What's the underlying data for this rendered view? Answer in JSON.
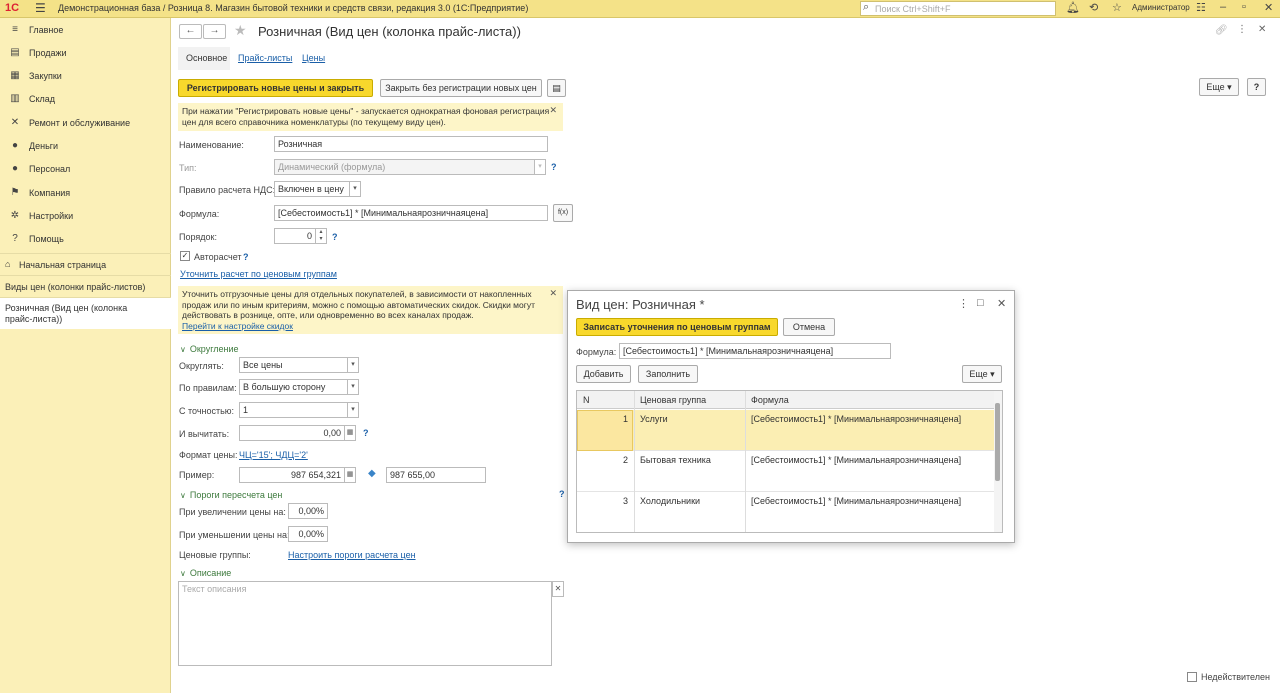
{
  "titlebar": {
    "logo": "1С",
    "title": "Демонстрационная база / Розница 8. Магазин бытовой техники и средств связи, редакция 3.0  (1С:Предприятие)",
    "search_placeholder": "Поиск Ctrl+Shift+F",
    "user": "Администратор"
  },
  "sidebar": {
    "items": [
      {
        "label": "Главное",
        "icon": "menu-icon"
      },
      {
        "label": "Продажи",
        "icon": "sales-icon"
      },
      {
        "label": "Закупки",
        "icon": "purchases-icon"
      },
      {
        "label": "Склад",
        "icon": "warehouse-icon"
      },
      {
        "label": "Ремонт и обслуживание",
        "icon": "wrench-icon"
      },
      {
        "label": "Деньги",
        "icon": "money-icon"
      },
      {
        "label": "Персонал",
        "icon": "person-icon"
      },
      {
        "label": "Компания",
        "icon": "flag-icon"
      },
      {
        "label": "Настройки",
        "icon": "gear-icon"
      },
      {
        "label": "Помощь",
        "icon": "help-icon"
      }
    ],
    "home": "Начальная страница",
    "open_windows": [
      "Виды цен (колонки прайс-листов)",
      "Розничная (Вид цен (колонка прайс-листа))"
    ]
  },
  "form": {
    "title": "Розничная (Вид цен (колонка прайс-листа))",
    "tabs": [
      "Основное",
      "Прайс-листы",
      "Цены"
    ],
    "btn_register": "Регистрировать новые цены и закрыть",
    "btn_close_no_reg": "Закрыть без регистрации новых цен",
    "btn_more": "Еще",
    "note1": "При нажатии \"Регистрировать новые цены\" - запускается однократная фоновая регистрация цен для всего справочника номенклатуры (по текущему виду цен).",
    "name_label": "Наименование:",
    "name_value": "Розничная",
    "type_label": "Тип:",
    "type_value": "Динамический (формула)",
    "vat_label": "Правило расчета НДС:",
    "vat_value": "Включен в цену",
    "formula_label": "Формула:",
    "formula_value": "[Себестоимость1] * [Минимальнаярозничнаяцена]",
    "order_label": "Порядок:",
    "order_value": "0",
    "autocalc_label": "Авторасчет",
    "refine_link": "Уточнить расчет по ценовым группам",
    "note2": "Уточнить отгрузочные цены для отдельных покупателей, в зависимости от накопленных продаж или по иным критериям, можно с помощью автоматических скидок. Скидки могут действовать в рознице, опте, или одновременно во всех каналах продаж.",
    "note2_link": "Перейти к настройке скидок",
    "rounding_section": "Округление",
    "round_label": "Округлять:",
    "round_value": "Все цены",
    "rule_label": "По правилам:",
    "rule_value": "В большую сторону",
    "precision_label": "С точностью:",
    "precision_value": "1",
    "subtract_label": "И вычитать:",
    "subtract_value": "0,00",
    "format_label": "Формат цены:",
    "format_value": "ЧЦ='15'; ЧДЦ='2'",
    "example_label": "Пример:",
    "example_value": "987 654,321",
    "example_result": "987 655,00",
    "thresholds_section": "Пороги пересчета цен",
    "increase_label": "При увеличении цены на:",
    "increase_value": "0,00%",
    "decrease_label": "При уменьшении цены на:",
    "decrease_value": "0,00%",
    "groups_label": "Ценовые группы:",
    "groups_link": "Настроить пороги расчета цен",
    "description_section": "Описание",
    "description_placeholder": "Текст описания",
    "invalid_label": "Недействителен",
    "question_mark": "?"
  },
  "dialog": {
    "title": "Вид цен: Розничная *",
    "btn_save": "Записать уточнения по ценовым группам",
    "btn_cancel": "Отмена",
    "formula_label": "Формула:",
    "formula_value": "[Себестоимость1] * [Минимальнаярозничнаяцена]",
    "btn_add": "Добавить",
    "btn_fill": "Заполнить",
    "btn_more": "Еще",
    "columns": [
      "N",
      "Ценовая группа",
      "Формула"
    ],
    "rows": [
      {
        "n": "1",
        "group": "Услуги",
        "formula": "[Себестоимость1] * [Минимальнаярозничнаяцена]"
      },
      {
        "n": "2",
        "group": "Бытовая техника",
        "formula": "[Себестоимость1] * [Минимальнаярозничнаяцена]"
      },
      {
        "n": "3",
        "group": "Холодильники",
        "formula": "[Себестоимость1] * [Минимальнаярозничнаяцена]"
      }
    ]
  },
  "colors": {
    "accent_yellow": "#f8d82c",
    "sidebar": "#fbf0b8",
    "link": "#1a5fa8",
    "section": "#3d7a3d"
  }
}
